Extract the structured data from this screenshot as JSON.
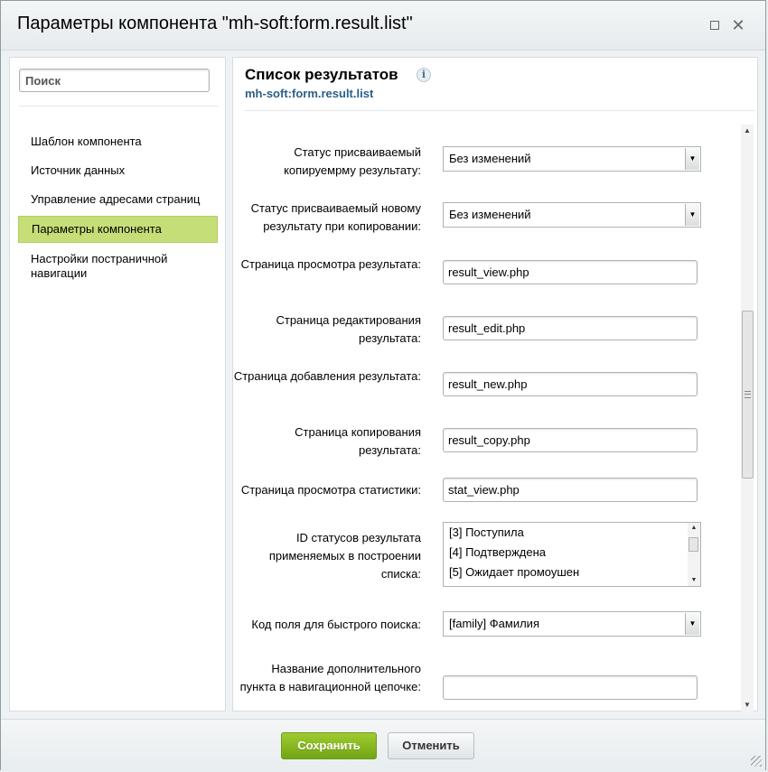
{
  "window": {
    "title": "Параметры компонента \"mh-soft:form.result.list\"",
    "maximize_icon": "maximize-icon",
    "close_icon": "close-icon"
  },
  "sidebar": {
    "search": {
      "placeholder": "Поиск",
      "value": ""
    },
    "items": [
      {
        "label": "Шаблон компонента",
        "active": false
      },
      {
        "label": "Источник данных",
        "active": false
      },
      {
        "label": "Управление адресами страниц",
        "active": false
      },
      {
        "label": "Параметры компонента",
        "active": true
      },
      {
        "label": "Настройки постраничной навигации",
        "active": false
      }
    ],
    "active_color": "#c5de78"
  },
  "main": {
    "title": "Список результатов",
    "info_icon": "info-icon",
    "info_glyph": "i",
    "subtitle": "mh-soft:form.result.list",
    "fields": {
      "status_copy": {
        "label": "Статус присваиваемый копируемрму результату:",
        "value": "Без изменений"
      },
      "status_new_copy": {
        "label": "Статус присваиваемый новому результату при копировании:",
        "value": "Без изменений"
      },
      "view_page": {
        "label": "Страница просмотра результата:",
        "value": "result_view.php"
      },
      "edit_page": {
        "label": "Страница редактирования результата:",
        "value": "result_edit.php"
      },
      "new_page": {
        "label": "Страница добавления результата:",
        "value": "result_new.php"
      },
      "copy_page": {
        "label": "Страница копирования результата:",
        "value": "result_copy.php"
      },
      "stat_page": {
        "label": "Страница просмотра статистики:",
        "value": "stat_view.php"
      },
      "status_ids": {
        "label": "ID статусов результата применяемых в построении списка:",
        "options": [
          "[3] Поступила",
          "[4] Подтверждена",
          "[5] Ожидает промоушен"
        ]
      },
      "quick_search": {
        "label": "Код поля для быстрого поиска:",
        "value": "[family] Фамилия"
      },
      "nav_chain": {
        "label": "Название дополнительного пункта в навигационной цепочке:",
        "value": ""
      }
    }
  },
  "footer": {
    "save_label": "Сохранить",
    "cancel_label": "Отменить",
    "save_color": "#80b41d"
  }
}
